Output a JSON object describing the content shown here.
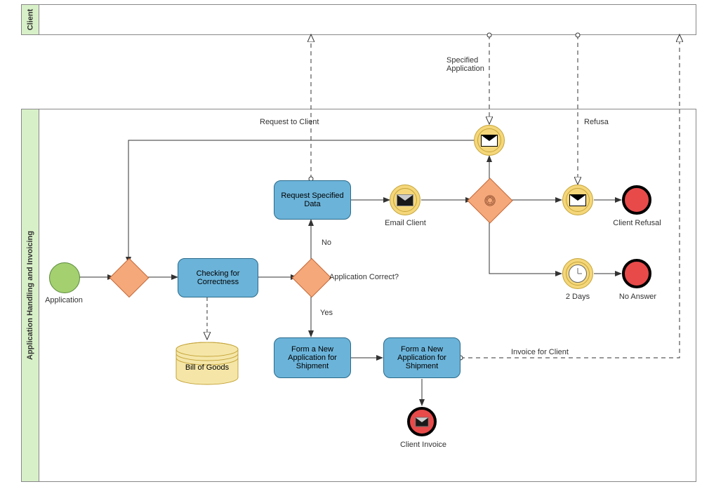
{
  "pools": {
    "client": "Client",
    "main": "Application Handling and Invoicing"
  },
  "events": {
    "start": "Application",
    "end_refusal": "Client Refusal",
    "end_noanswer": "No Answer",
    "end_invoice": "Client Invoice",
    "email_client": "Email Client",
    "two_days": "2 Days"
  },
  "tasks": {
    "check": "Checking for Correctness",
    "request": "Request Specified Data",
    "form1": "Form a New Application for Shipment",
    "form2": "Form a New Application for Shipment"
  },
  "gateways": {
    "correct": "Application Correct?",
    "no": "No",
    "yes": "Yes"
  },
  "data": {
    "bill": "Bill of Goods"
  },
  "messages": {
    "request_client": "Request to Client",
    "specified_app": "Specified Application",
    "refusal": "Refusa",
    "invoice": "Invoice for Client"
  },
  "chart_data": {
    "type": "bpmn",
    "pools": [
      "Client",
      "Application Handling and Invoicing"
    ],
    "elements": [
      {
        "id": "start",
        "type": "startEvent",
        "label": "Application",
        "pool": 1
      },
      {
        "id": "gw1",
        "type": "exclusiveGateway",
        "pool": 1
      },
      {
        "id": "check",
        "type": "task",
        "label": "Checking for Correctness",
        "pool": 1
      },
      {
        "id": "bill",
        "type": "dataStore",
        "label": "Bill of Goods",
        "pool": 1
      },
      {
        "id": "gw2",
        "type": "exclusiveGateway",
        "label": "Application Correct?",
        "pool": 1
      },
      {
        "id": "request",
        "type": "task",
        "label": "Request Specified Data",
        "pool": 1
      },
      {
        "id": "email",
        "type": "intermediateThrowEvent",
        "subtype": "message",
        "label": "Email Client",
        "pool": 1
      },
      {
        "id": "gw3",
        "type": "eventBasedGateway",
        "pool": 1
      },
      {
        "id": "catch_app",
        "type": "intermediateCatchEvent",
        "subtype": "message",
        "pool": 1
      },
      {
        "id": "catch_ref",
        "type": "intermediateCatchEvent",
        "subtype": "message",
        "pool": 1
      },
      {
        "id": "end_ref",
        "type": "endEvent",
        "label": "Client Refusal",
        "pool": 1
      },
      {
        "id": "timer",
        "type": "intermediateCatchEvent",
        "subtype": "timer",
        "label": "2 Days",
        "pool": 1
      },
      {
        "id": "end_na",
        "type": "endEvent",
        "label": "No Answer",
        "pool": 1
      },
      {
        "id": "form1",
        "type": "task",
        "label": "Form a New Application for Shipment",
        "pool": 1
      },
      {
        "id": "form2",
        "type": "task",
        "label": "Form a New Application for Shipment",
        "pool": 1
      },
      {
        "id": "end_inv",
        "type": "endEvent",
        "subtype": "message",
        "label": "Client Invoice",
        "pool": 1
      }
    ],
    "sequenceFlows": [
      {
        "from": "start",
        "to": "gw1"
      },
      {
        "from": "gw1",
        "to": "check"
      },
      {
        "from": "check",
        "to": "gw2"
      },
      {
        "from": "gw2",
        "to": "request",
        "condition": "No"
      },
      {
        "from": "gw2",
        "to": "form1",
        "condition": "Yes"
      },
      {
        "from": "request",
        "to": "email"
      },
      {
        "from": "email",
        "to": "gw3"
      },
      {
        "from": "gw3",
        "to": "catch_ref"
      },
      {
        "from": "gw3",
        "to": "timer"
      },
      {
        "from": "gw3",
        "to": "catch_app"
      },
      {
        "from": "catch_ref",
        "to": "end_ref"
      },
      {
        "from": "timer",
        "to": "end_na"
      },
      {
        "from": "catch_app",
        "to": "gw1"
      },
      {
        "from": "form1",
        "to": "form2"
      },
      {
        "from": "form2",
        "to": "end_inv"
      }
    ],
    "messageFlows": [
      {
        "from": "request",
        "to": "Client",
        "label": "Request to Client"
      },
      {
        "from": "Client",
        "to": "catch_app",
        "label": "Specified Application"
      },
      {
        "from": "Client",
        "to": "catch_ref",
        "label": "Refusa"
      },
      {
        "from": "form2",
        "to": "Client",
        "label": "Invoice for Client"
      }
    ],
    "dataAssociations": [
      {
        "from": "check",
        "to": "bill"
      }
    ]
  }
}
